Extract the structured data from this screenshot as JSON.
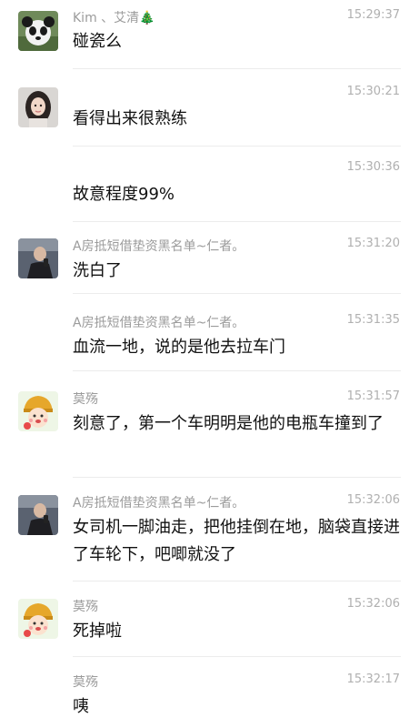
{
  "messages": [
    {
      "sender": "Kim 、艾清🎄",
      "time": "15:29:37",
      "text": "碰瓷么",
      "avatar": "panda-avatar-icon"
    },
    {
      "sender": "",
      "time": "15:30:21",
      "text": "看得出来很熟练",
      "avatar": "woman-avatar-icon"
    },
    {
      "sender": "",
      "time": "15:30:36",
      "text": "故意程度99%",
      "avatar": ""
    },
    {
      "sender": "A房抵短借垫资黑名单~仁者。",
      "time": "15:31:20",
      "text": "洗白了",
      "avatar": "man-avatar-icon"
    },
    {
      "sender": "A房抵短借垫资黑名单~仁者。",
      "time": "15:31:35",
      "text": "血流一地，说的是他去拉车门",
      "avatar": ""
    },
    {
      "sender": "莫殇",
      "time": "15:31:57",
      "text": "刻意了，第一个车明明是他的电瓶车撞到了",
      "avatar": "cartoon-avatar-icon"
    },
    {
      "sender": "A房抵短借垫资黑名单~仁者。",
      "time": "15:32:06",
      "text": "女司机一脚油走，把他挂倒在地，脑袋直接进了车轮下，吧唧就没了",
      "avatar": "man-avatar-icon"
    },
    {
      "sender": "莫殇",
      "time": "15:32:06",
      "text": "死掉啦",
      "avatar": "cartoon-avatar-icon"
    },
    {
      "sender": "莫殇",
      "time": "15:32:17",
      "text": "咦",
      "avatar": ""
    }
  ],
  "colors": {
    "sender": "#9b9b9b",
    "time": "#b0b0b0",
    "text": "#111111",
    "separator": "#ececec"
  }
}
